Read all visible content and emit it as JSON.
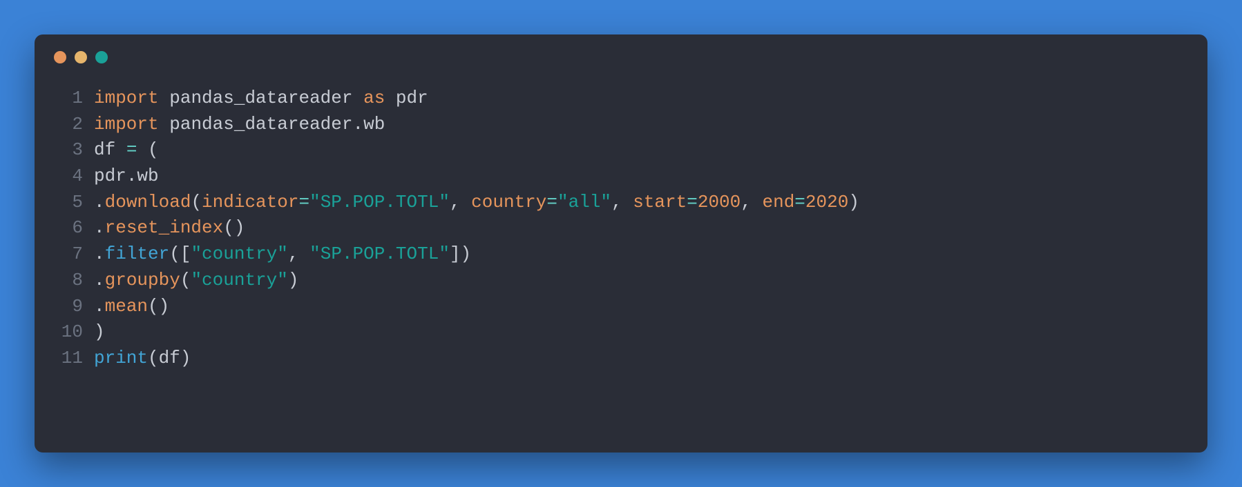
{
  "window": {
    "dots": [
      "red",
      "yellow",
      "green"
    ]
  },
  "code": {
    "lines": [
      {
        "n": "1",
        "tokens": [
          {
            "t": "import",
            "c": "kw"
          },
          {
            "t": " ",
            "c": "ident"
          },
          {
            "t": "pandas_datareader",
            "c": "ident"
          },
          {
            "t": " ",
            "c": "ident"
          },
          {
            "t": "as",
            "c": "kw"
          },
          {
            "t": " ",
            "c": "ident"
          },
          {
            "t": "pdr",
            "c": "ident"
          }
        ]
      },
      {
        "n": "2",
        "tokens": [
          {
            "t": "import",
            "c": "kw"
          },
          {
            "t": " ",
            "c": "ident"
          },
          {
            "t": "pandas_datareader",
            "c": "ident"
          },
          {
            "t": ".",
            "c": "punct"
          },
          {
            "t": "wb",
            "c": "ident"
          }
        ]
      },
      {
        "n": "3",
        "tokens": [
          {
            "t": "df ",
            "c": "ident"
          },
          {
            "t": "=",
            "c": "op"
          },
          {
            "t": " (",
            "c": "punct"
          }
        ]
      },
      {
        "n": "4",
        "tokens": [
          {
            "t": "pdr",
            "c": "ident"
          },
          {
            "t": ".",
            "c": "punct"
          },
          {
            "t": "wb",
            "c": "ident"
          }
        ]
      },
      {
        "n": "5",
        "tokens": [
          {
            "t": ".",
            "c": "punct"
          },
          {
            "t": "download",
            "c": "func"
          },
          {
            "t": "(",
            "c": "punct"
          },
          {
            "t": "indicator",
            "c": "param"
          },
          {
            "t": "=",
            "c": "op"
          },
          {
            "t": "\"SP.POP.TOTL\"",
            "c": "str"
          },
          {
            "t": ", ",
            "c": "punct"
          },
          {
            "t": "country",
            "c": "param"
          },
          {
            "t": "=",
            "c": "op"
          },
          {
            "t": "\"all\"",
            "c": "str"
          },
          {
            "t": ", ",
            "c": "punct"
          },
          {
            "t": "start",
            "c": "param"
          },
          {
            "t": "=",
            "c": "op"
          },
          {
            "t": "2000",
            "c": "num"
          },
          {
            "t": ", ",
            "c": "punct"
          },
          {
            "t": "end",
            "c": "param"
          },
          {
            "t": "=",
            "c": "op"
          },
          {
            "t": "2020",
            "c": "num"
          },
          {
            "t": ")",
            "c": "punct"
          }
        ]
      },
      {
        "n": "6",
        "tokens": [
          {
            "t": ".",
            "c": "punct"
          },
          {
            "t": "reset_index",
            "c": "func"
          },
          {
            "t": "()",
            "c": "punct"
          }
        ]
      },
      {
        "n": "7",
        "tokens": [
          {
            "t": ".",
            "c": "punct"
          },
          {
            "t": "filter",
            "c": "builtin"
          },
          {
            "t": "([",
            "c": "punct"
          },
          {
            "t": "\"country\"",
            "c": "str"
          },
          {
            "t": ", ",
            "c": "punct"
          },
          {
            "t": "\"SP.POP.TOTL\"",
            "c": "str"
          },
          {
            "t": "])",
            "c": "punct"
          }
        ]
      },
      {
        "n": "8",
        "tokens": [
          {
            "t": ".",
            "c": "punct"
          },
          {
            "t": "groupby",
            "c": "func"
          },
          {
            "t": "(",
            "c": "punct"
          },
          {
            "t": "\"country\"",
            "c": "str"
          },
          {
            "t": ")",
            "c": "punct"
          }
        ]
      },
      {
        "n": "9",
        "tokens": [
          {
            "t": ".",
            "c": "punct"
          },
          {
            "t": "mean",
            "c": "func"
          },
          {
            "t": "()",
            "c": "punct"
          }
        ]
      },
      {
        "n": "10",
        "tokens": [
          {
            "t": ")",
            "c": "punct"
          }
        ]
      },
      {
        "n": "11",
        "tokens": [
          {
            "t": "print",
            "c": "builtin"
          },
          {
            "t": "(",
            "c": "punct"
          },
          {
            "t": "df",
            "c": "ident"
          },
          {
            "t": ")",
            "c": "punct"
          }
        ]
      }
    ]
  }
}
